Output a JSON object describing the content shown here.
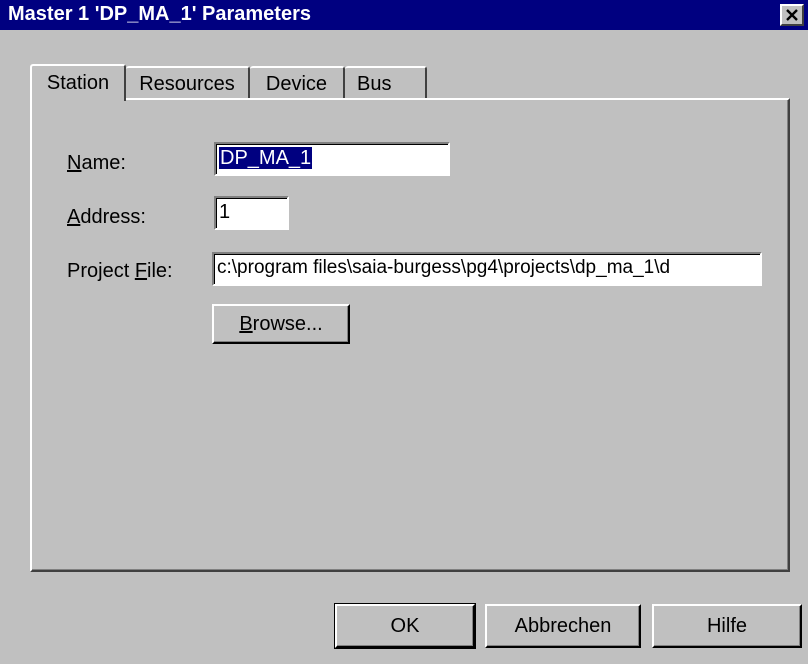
{
  "window": {
    "title": "Master 1 'DP_MA_1' Parameters",
    "close_icon": "close-icon"
  },
  "tabs": [
    {
      "label": "Station",
      "active": true
    },
    {
      "label": "Resources",
      "active": false
    },
    {
      "label": "Device",
      "active": false
    },
    {
      "label": "Bus",
      "active": false
    }
  ],
  "station": {
    "name_label_mnemonic": "N",
    "name_label_rest": "ame:",
    "name_value": "DP_MA_1",
    "address_label_mnemonic": "A",
    "address_label_rest": "ddress:",
    "address_value": "1",
    "project_file_label_prefix": "Project ",
    "project_file_label_mnemonic": "F",
    "project_file_label_rest": "ile:",
    "project_file_value": "c:\\program files\\saia-burgess\\pg4\\projects\\dp_ma_1\\d",
    "browse_mnemonic": "B",
    "browse_rest": "rowse..."
  },
  "buttons": {
    "ok": "OK",
    "cancel": "Abbrechen",
    "help": "Hilfe"
  },
  "colors": {
    "titlebar": "#000080",
    "face": "#c0c0c0",
    "selection": "#000080"
  }
}
